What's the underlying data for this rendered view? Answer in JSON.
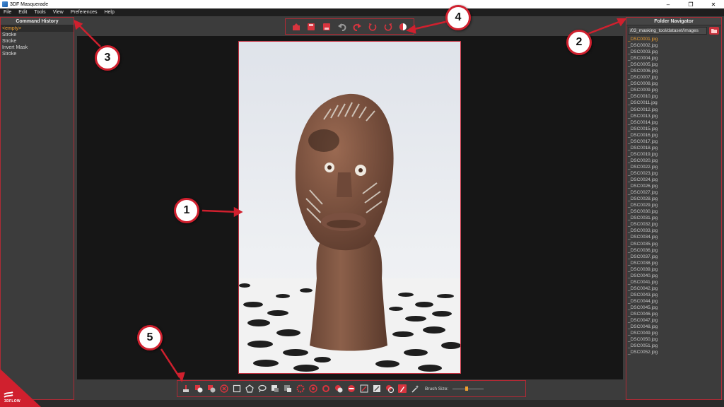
{
  "window": {
    "title": "3DF Masquerade",
    "controls": [
      "–",
      "❐",
      "✕"
    ]
  },
  "menu": [
    "File",
    "Edit",
    "Tools",
    "View",
    "Preferences",
    "Help"
  ],
  "command_history": {
    "title": "Command History",
    "items": [
      "<empty>",
      "Stroke",
      "Stroke",
      "Invert Mask",
      "Stroke"
    ]
  },
  "folder_navigator": {
    "title": "Folder Navigator",
    "path": "/03_masking_tool/dataset/images",
    "files": [
      "_DSC0001.jpg",
      "_DSC0002.jpg",
      "_DSC0003.jpg",
      "_DSC0004.jpg",
      "_DSC0005.jpg",
      "_DSC0006.jpg",
      "_DSC0007.jpg",
      "_DSC0008.jpg",
      "_DSC0009.jpg",
      "_DSC0010.jpg",
      "_DSC0011.jpg",
      "_DSC0012.jpg",
      "_DSC0013.jpg",
      "_DSC0014.jpg",
      "_DSC0015.jpg",
      "_DSC0016.jpg",
      "_DSC0017.jpg",
      "_DSC0018.jpg",
      "_DSC0019.jpg",
      "_DSC0020.jpg",
      "_DSC0022.jpg",
      "_DSC0023.jpg",
      "_DSC0024.jpg",
      "_DSC0026.jpg",
      "_DSC0027.jpg",
      "_DSC0028.jpg",
      "_DSC0029.jpg",
      "_DSC0030.jpg",
      "_DSC0031.jpg",
      "_DSC0032.jpg",
      "_DSC0033.jpg",
      "_DSC0034.jpg",
      "_DSC0035.jpg",
      "_DSC0036.jpg",
      "_DSC0037.jpg",
      "_DSC0038.jpg",
      "_DSC0039.jpg",
      "_DSC0040.jpg",
      "_DSC0041.jpg",
      "_DSC0042.jpg",
      "_DSC0043.jpg",
      "_DSC0044.jpg",
      "_DSC0045.jpg",
      "_DSC0046.jpg",
      "_DSC0047.jpg",
      "_DSC0048.jpg",
      "_DSC0049.jpg",
      "_DSC0050.jpg",
      "_DSC0051.jpg",
      "_DSC0052.jpg"
    ],
    "selected_index": 0
  },
  "top_toolbar": [
    "open-icon",
    "save-icon",
    "save-as-icon",
    "undo-icon",
    "redo-icon",
    "rotate-left-icon",
    "rotate-right-icon",
    "contrast-icon"
  ],
  "bottom_toolbar": [
    "brush-clear-icon",
    "add-mask-icon",
    "subtract-mask-icon",
    "cancel-icon",
    "rectangle-select-icon",
    "polygon-select-icon",
    "lasso-select-icon",
    "mask-fill-icon",
    "mask-invert-icon",
    "magic-wand-red-icon",
    "target-icon",
    "ring-icon",
    "mask-on-icon",
    "mask-off-icon",
    "line-brush-icon",
    "eraser-brush-icon",
    "color-picker-icon",
    "brush-active-icon",
    "magic-stick-icon"
  ],
  "brush": {
    "label": "Brush Size:",
    "value_fraction": 0.45
  },
  "callouts": [
    "1",
    "2",
    "3",
    "4",
    "5"
  ],
  "logo": {
    "text": "3DFLOW"
  },
  "colors": {
    "accent": "#c83242",
    "selected": "#f0a030",
    "panel": "#3c3c3c",
    "canvas": "#161616"
  }
}
